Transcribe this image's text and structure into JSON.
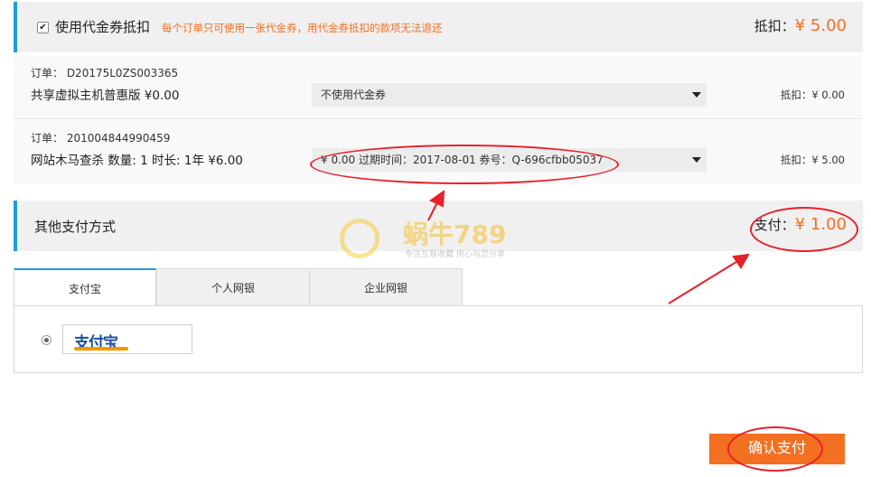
{
  "coupon_section": {
    "checkbox_mark": "✔",
    "title": "使用代金券抵扣",
    "note": "每个订单只可使用一张代金券，用代金券抵扣的款项无法退还",
    "deduct_label": "抵扣：",
    "deduct_value": "¥ 5.00"
  },
  "orders": [
    {
      "order_no": "订单： D20175L0ZS003365",
      "description": "共享虚拟主机普惠版   ¥0.00",
      "coupon_selected": "不使用代金券",
      "deduct": "抵扣：¥ 0.00"
    },
    {
      "order_no": "订单： 201004844990459",
      "description": "网站木马查杀 数量: 1 时长: 1年   ¥6.00",
      "coupon_selected": "¥ 0.00  过期时间：2017-08-01  券号：Q-696cfbb05037",
      "deduct": "抵扣：¥ 5.00"
    }
  ],
  "other_payment": {
    "title": "其他支付方式",
    "pay_label": "支付：",
    "pay_value": "¥ 1.00"
  },
  "tabs": [
    {
      "label": "支付宝",
      "active": true
    },
    {
      "label": "个人网银",
      "active": false
    },
    {
      "label": "企业网银",
      "active": false
    }
  ],
  "payment_option": {
    "logo_text": "支付宝"
  },
  "watermark": {
    "text": "蜗牛789",
    "sub": "专注互联收藏   用心与您分享"
  },
  "confirm_button": "确认支付",
  "colors": {
    "accent_blue": "#1a9fdb",
    "accent_orange": "#f36f21",
    "annotation_red": "#e8202a"
  }
}
